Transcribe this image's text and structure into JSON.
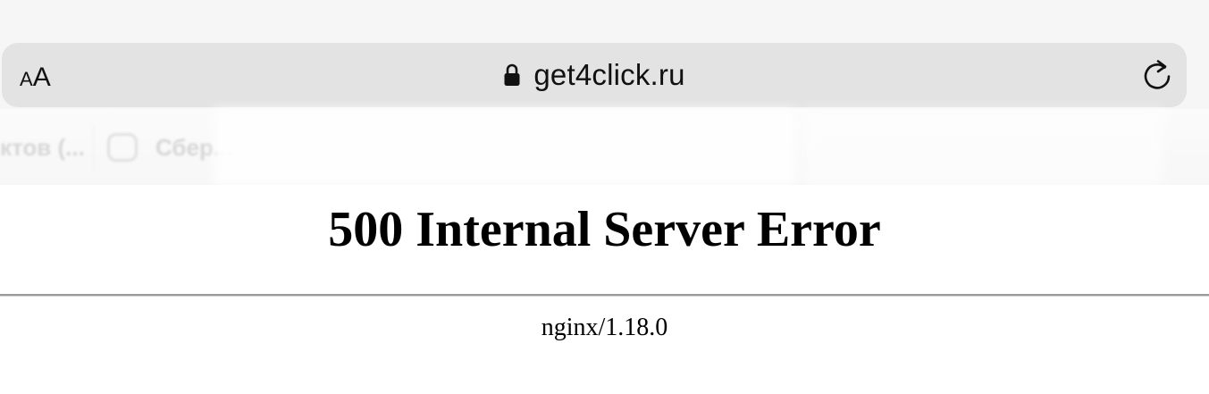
{
  "browser": {
    "text_size_button": {
      "small": "A",
      "large": "A"
    },
    "url": "get4click.ru",
    "lock_icon": "lock-icon",
    "reload_icon": "reload-icon"
  },
  "tabs": [
    {
      "label": "ктов (..."
    },
    {
      "label": "Сбер..."
    }
  ],
  "page": {
    "title": "500 Internal Server Error",
    "server": "nginx/1.18.0"
  }
}
